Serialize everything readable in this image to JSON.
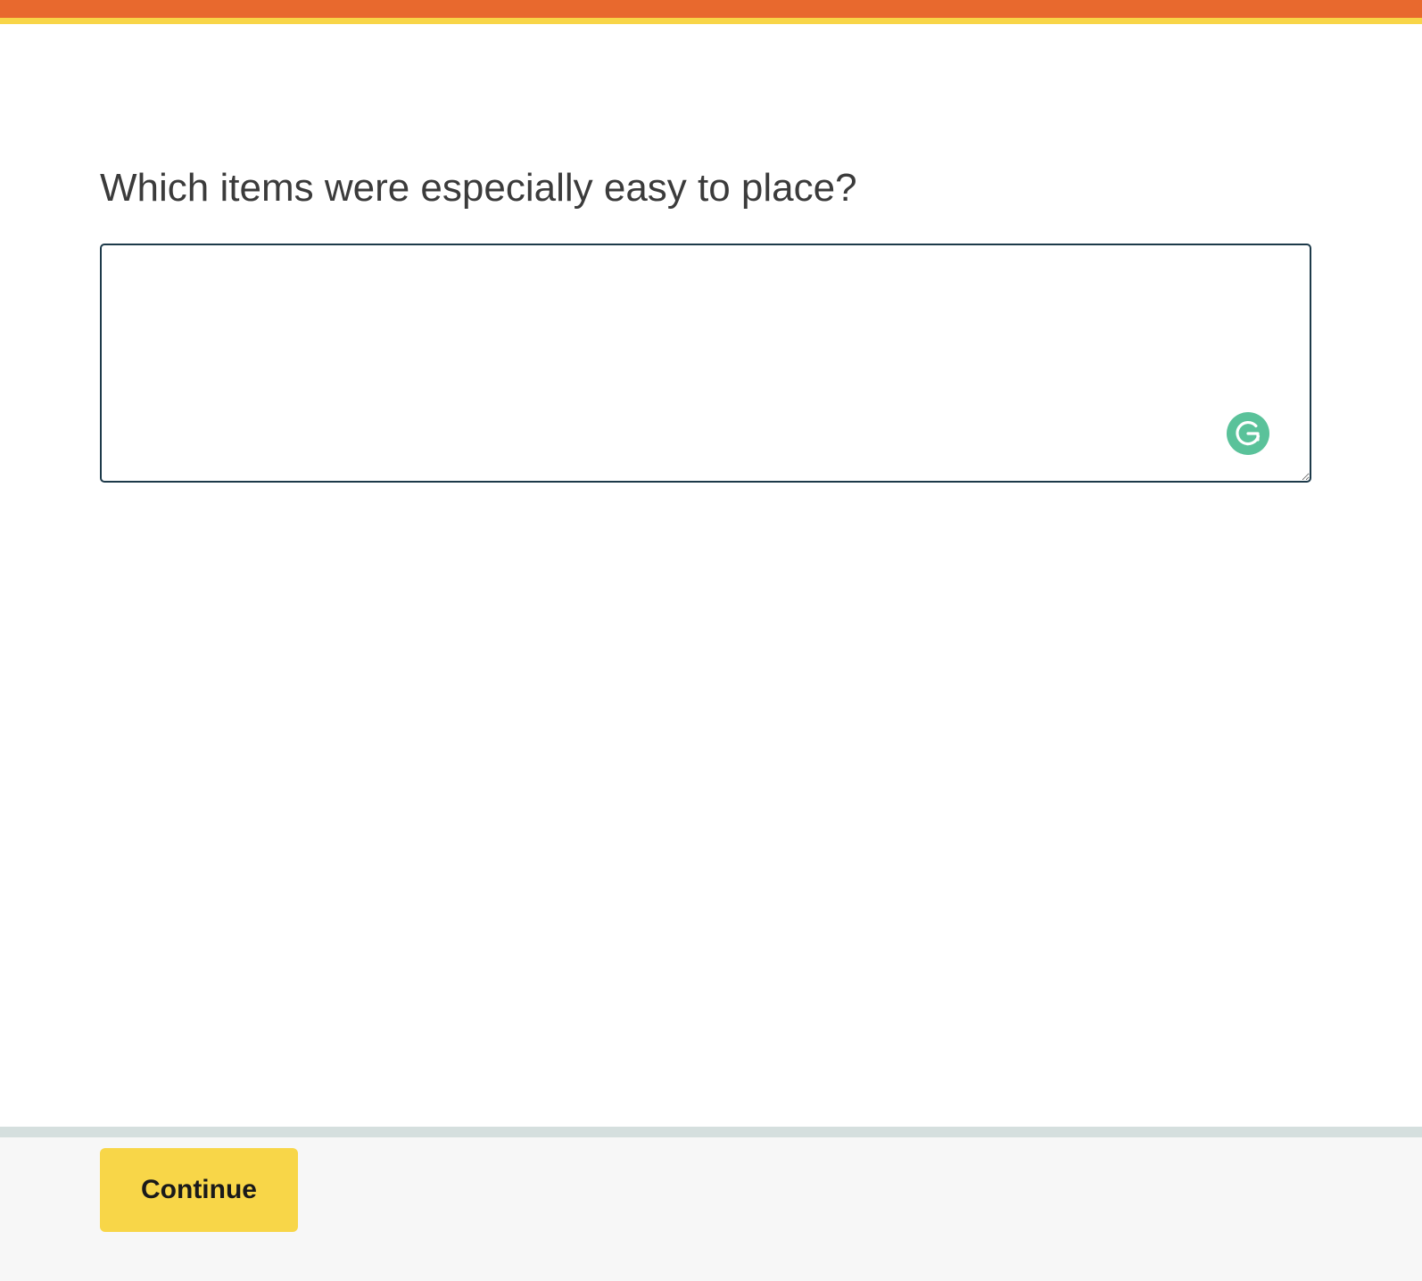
{
  "question": {
    "text": "Which items were especially easy to place?"
  },
  "answer": {
    "value": "",
    "placeholder": ""
  },
  "grammarly": {
    "icon": "grammarly-icon",
    "color": "#5ac29a"
  },
  "footer": {
    "continue_label": "Continue"
  },
  "colors": {
    "top_bar": "#e8692e",
    "top_bar_accent": "#f8d548",
    "button": "#f8d648",
    "input_border": "#1d3a4a"
  }
}
